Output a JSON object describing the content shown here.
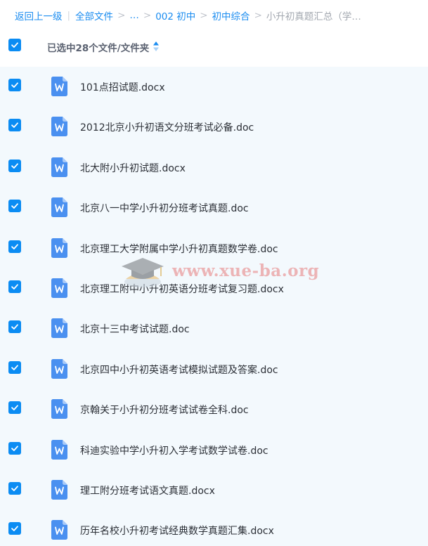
{
  "breadcrumb": {
    "back": "返回上一级",
    "all_files": "全部文件",
    "ellipsis": "…",
    "crumb_1": "002 初中",
    "crumb_2": "初中综合",
    "current": "小升初真题汇总（学…"
  },
  "header": {
    "selected_text": "已选中28个文件/文件夹"
  },
  "colors": {
    "accent": "#0b8cf3",
    "link": "#1a8cf0",
    "row_background": "#f3f9fd",
    "doc_icon": "#4a90f0"
  },
  "files": [
    {
      "name": "101点招试题.docx",
      "checked": true,
      "icon": "word-doc-icon"
    },
    {
      "name": "2012北京小升初语文分班考试必备.doc",
      "checked": true,
      "icon": "word-doc-icon"
    },
    {
      "name": "北大附小升初试题.docx",
      "checked": true,
      "icon": "word-doc-icon"
    },
    {
      "name": "北京八一中学小升初分班考试真题.doc",
      "checked": true,
      "icon": "word-doc-icon"
    },
    {
      "name": "北京理工大学附属中学小升初真题数学卷.doc",
      "checked": true,
      "icon": "word-doc-icon"
    },
    {
      "name": "北京理工附中小升初英语分班考试复习题.docx",
      "checked": true,
      "icon": "word-doc-icon"
    },
    {
      "name": "北京十三中考试试题.doc",
      "checked": true,
      "icon": "word-doc-icon"
    },
    {
      "name": "北京四中小升初英语考试模拟试题及答案.doc",
      "checked": true,
      "icon": "word-doc-icon"
    },
    {
      "name": "京翰关于小升初分班考试试卷全科.doc",
      "checked": true,
      "icon": "word-doc-icon"
    },
    {
      "name": "科迪实验中学小升初入学考试数学试卷.doc",
      "checked": true,
      "icon": "word-doc-icon"
    },
    {
      "name": "理工附分班考试语文真题.docx",
      "checked": true,
      "icon": "word-doc-icon"
    },
    {
      "name": "历年名校小升初考试经典数学真题汇集.docx",
      "checked": true,
      "icon": "word-doc-icon"
    }
  ],
  "watermark": {
    "text": "www.xue-ba.org"
  }
}
